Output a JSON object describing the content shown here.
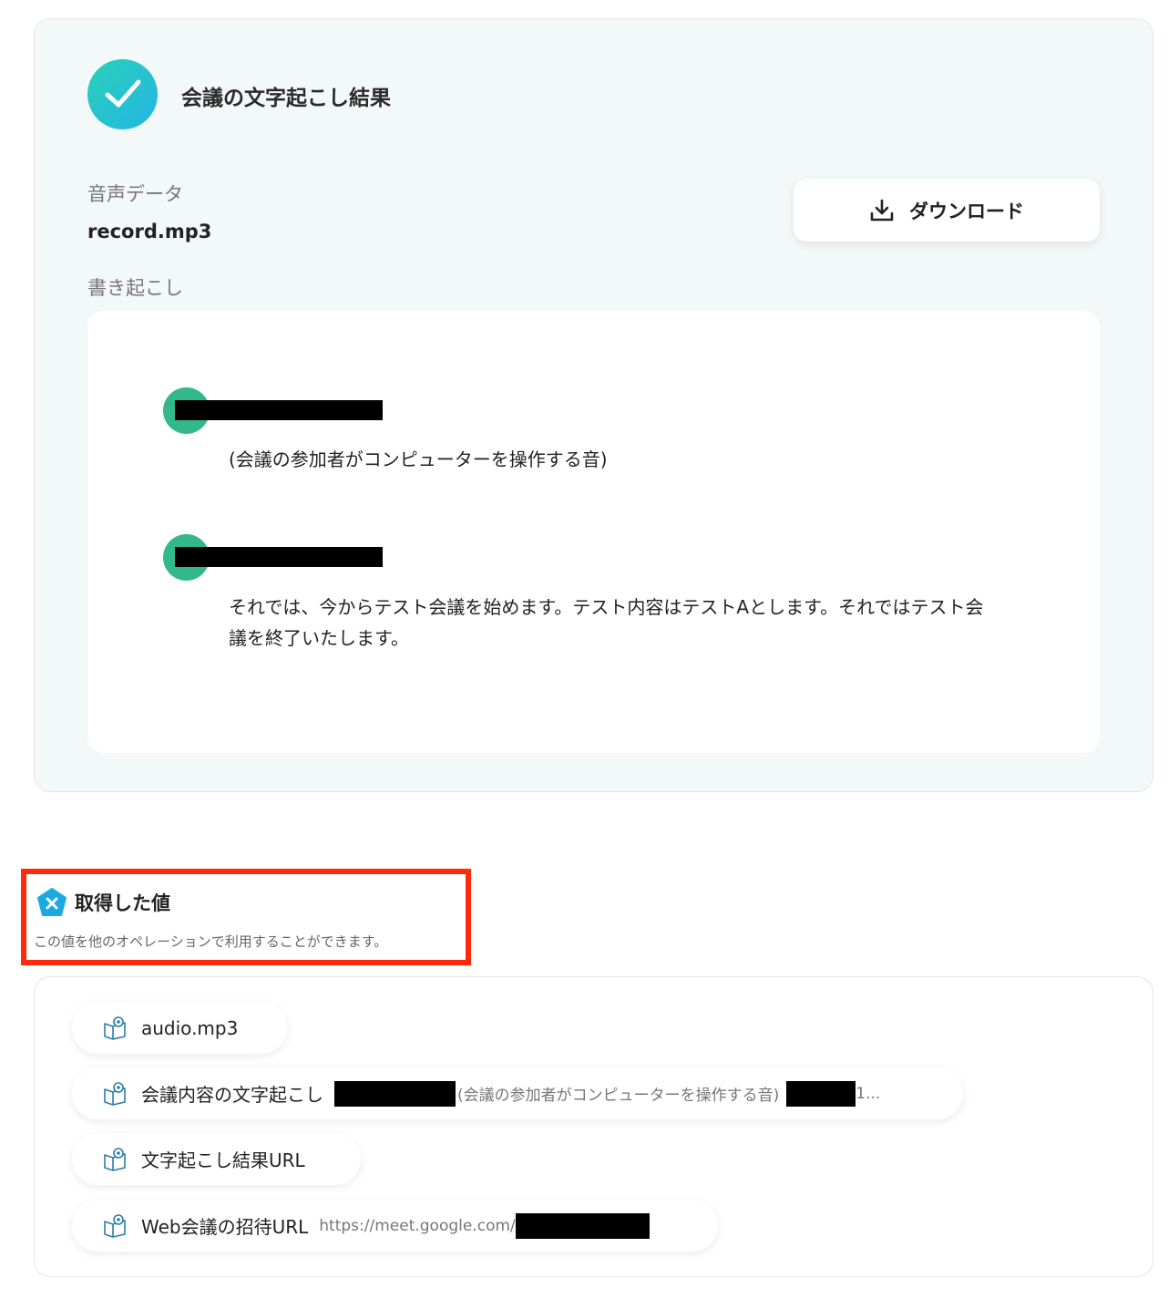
{
  "result": {
    "title": "会議の文字起こし結果",
    "audio_label": "音声データ",
    "audio_value": "record.mp3",
    "transcript_label": "書き起こし",
    "download_label": "ダウンロード",
    "utterances": [
      {
        "text": "(会議の参加者がコンピューターを操作する音)"
      },
      {
        "line1": "それでは、今からテスト会議を始めます。テスト内容はテストAとします。それではテスト会",
        "line2": "議を終了いたします。"
      }
    ]
  },
  "values_section": {
    "title": "取得した値",
    "subtitle": "この値を他のオペレーションで利用することができます。",
    "chips": [
      {
        "name": "audio.mp3",
        "value": ""
      },
      {
        "name": "会議内容の文字起こし",
        "value": "(会議の参加者がコンピューターを操作する音)",
        "tail": "1..."
      },
      {
        "name": "文字起こし結果URL",
        "value": ""
      },
      {
        "name": "Web会議の招待URL",
        "value": "https://meet.google.com/"
      }
    ]
  },
  "colors": {
    "accent": "#23b6e6",
    "speaker": "#33b88c",
    "highlight": "#ff2a0c"
  },
  "icons": [
    "check-icon",
    "download-icon",
    "pentagon-x-icon",
    "book-eye-icon"
  ]
}
